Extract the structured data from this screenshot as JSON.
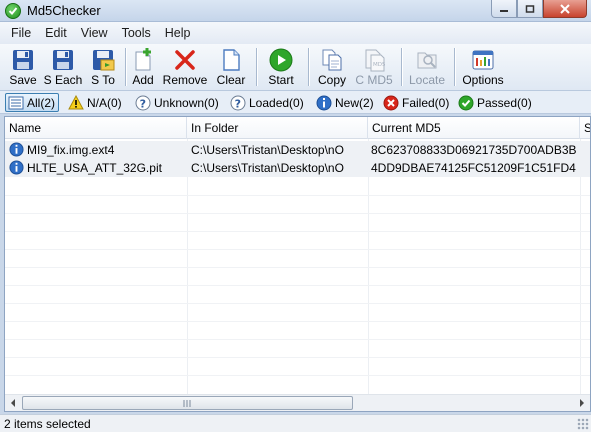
{
  "window": {
    "title": "Md5Checker"
  },
  "menu": [
    "File",
    "Edit",
    "View",
    "Tools",
    "Help"
  ],
  "toolbar": {
    "save": "Save",
    "save_each": "S Each",
    "save_to": "S To",
    "add": "Add",
    "remove": "Remove",
    "clear": "Clear",
    "start": "Start",
    "copy": "Copy",
    "c_md5": "C MD5",
    "locate": "Locate",
    "options": "Options"
  },
  "filters": {
    "all": "All(2)",
    "na": "N/A(0)",
    "unknown": "Unknown(0)",
    "loaded": "Loaded(0)",
    "new": "New(2)",
    "failed": "Failed(0)",
    "passed": "Passed(0)"
  },
  "list": {
    "columns": {
      "name": "Name",
      "folder": "In Folder",
      "md5": "Current MD5",
      "extra": "S"
    },
    "rows": [
      {
        "name": "MI9_fix.img.ext4",
        "folder": "C:\\Users\\Tristan\\Desktop\\nO",
        "md5": "8C623708833D06921735D700ADB3B..."
      },
      {
        "name": "HLTE_USA_ATT_32G.pit",
        "folder": "C:\\Users\\Tristan\\Desktop\\nO",
        "md5": "4DD9DBAE74125FC51209F1C51FD46..."
      }
    ]
  },
  "status": {
    "text": "2 items selected"
  },
  "icons": {
    "app": "checkmark-circle-icon",
    "save": "floppy-disk-icon",
    "add": "add-file-icon",
    "remove": "red-x-icon",
    "clear": "blank-document-icon",
    "start": "green-play-icon",
    "copy": "copy-icon",
    "c_md5": "md5-document-icon",
    "locate": "locate-icon",
    "options": "options-icon",
    "row": "info-icon"
  }
}
